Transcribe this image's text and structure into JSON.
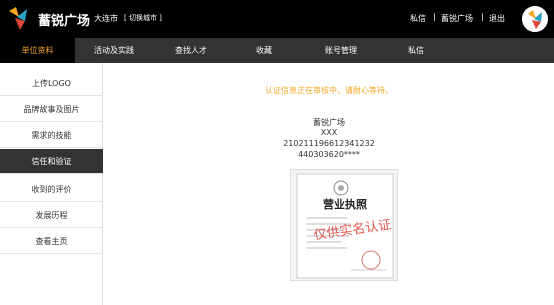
{
  "header": {
    "brand": "蓄锐广场",
    "city": "大连市",
    "switch_label": "[ 切换城市 ]",
    "links": {
      "messages": "私信",
      "user": "蓄锐广场",
      "separator": "|",
      "logout": "退出"
    }
  },
  "nav": {
    "items": [
      "单位资料",
      "活动及实践",
      "查找人才",
      "收藏",
      "账号管理",
      "私信"
    ],
    "active_index": 0
  },
  "sidebar": {
    "items": [
      "上传LOGO",
      "品牌故事及图片",
      "需求的技能",
      "信任和验证",
      "收到的评价",
      "发展历程",
      "查看主页"
    ],
    "active_index": 3
  },
  "main": {
    "notice": "认证信息正在审核中，请耐心等待。",
    "org_name": "蓄锐广场",
    "contact_name": "XXX",
    "id_number": "210211196612341232",
    "license_number": "440303620****",
    "license_image": {
      "title": "营业执照",
      "watermark": "仅供实名认证"
    }
  },
  "colors": {
    "topbar": "#000000",
    "nav": "#333333",
    "accent": "#f5a623",
    "watermark": "#e0453a"
  }
}
